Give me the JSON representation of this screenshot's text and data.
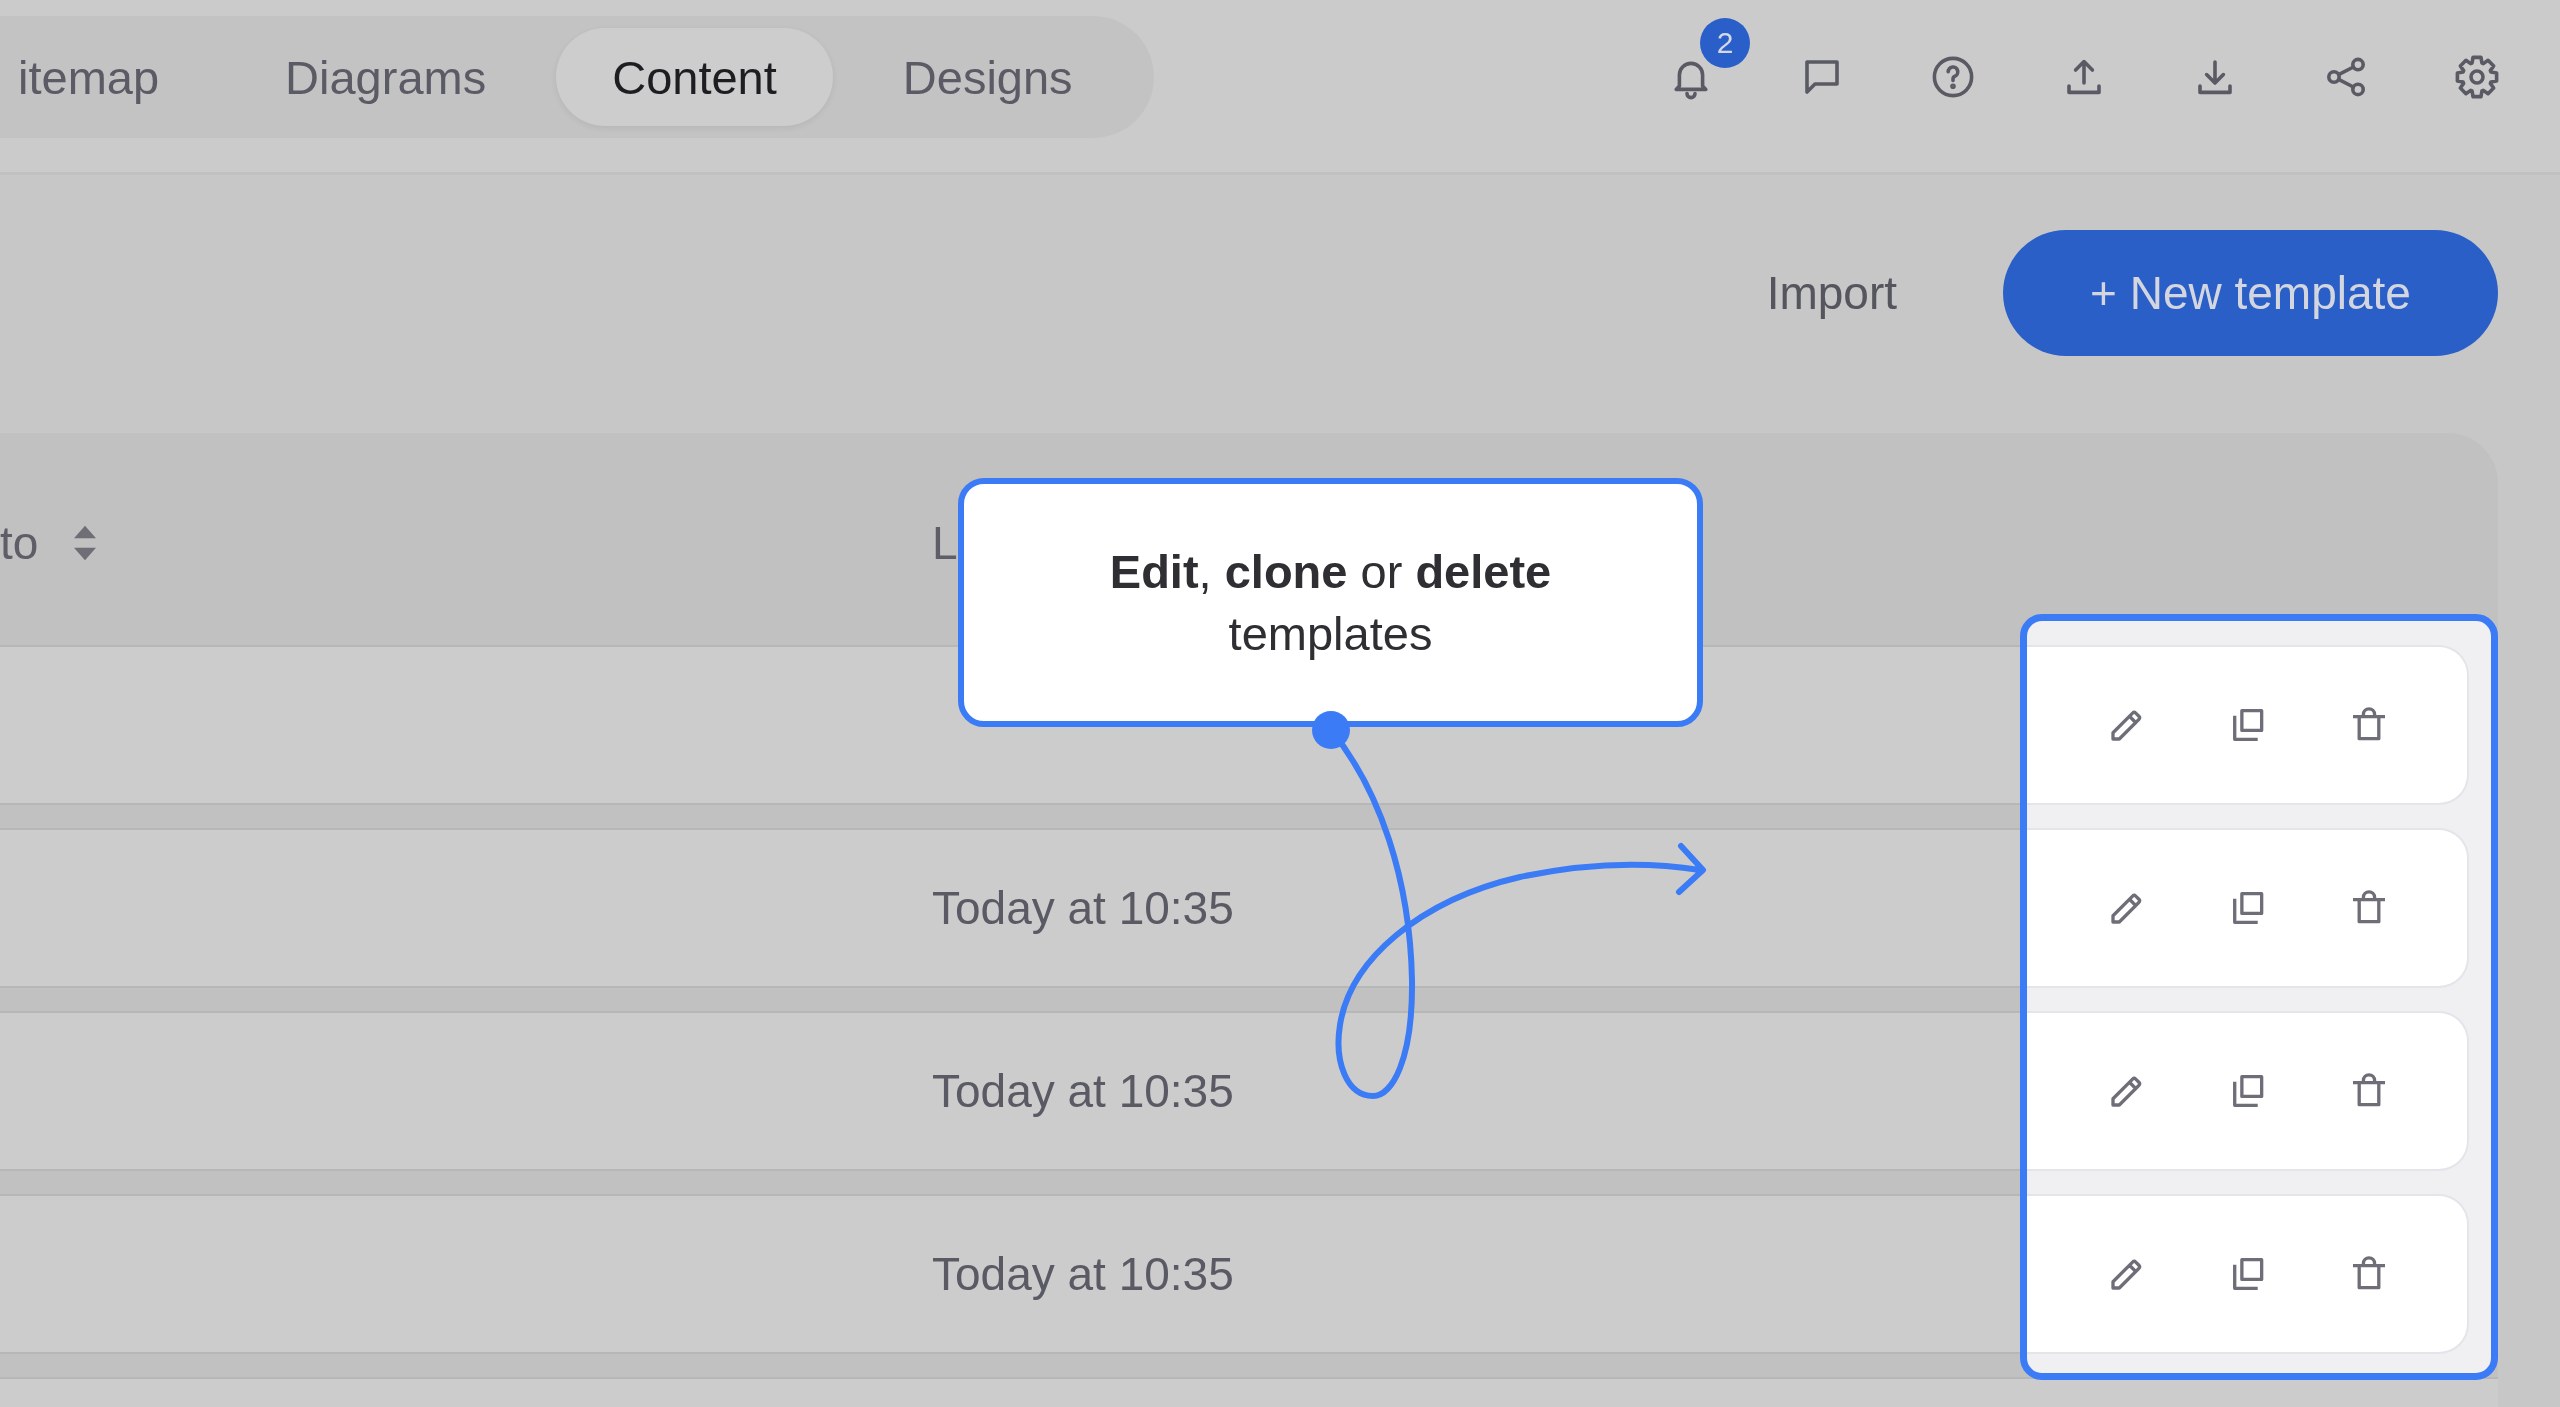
{
  "tabs": [
    {
      "label": "itemap",
      "selected": false
    },
    {
      "label": "Diagrams",
      "selected": false
    },
    {
      "label": "Content",
      "selected": true
    },
    {
      "label": "Designs",
      "selected": false
    }
  ],
  "toolbar": {
    "notification_badge": "2"
  },
  "actions": {
    "import": "Import",
    "new_template": "+ New template"
  },
  "table": {
    "columns": [
      {
        "label": "to",
        "sortable": true
      },
      {
        "label": "L",
        "sortable": false
      }
    ],
    "rows": [
      {},
      {
        "column_2": "Today at 10:35"
      },
      {
        "column_2": "Today at 10:35"
      },
      {
        "column_2": "Today at 10:35"
      }
    ]
  },
  "tooltip": {
    "text": "**Edit**, **clone** or **delete** templates"
  }
}
